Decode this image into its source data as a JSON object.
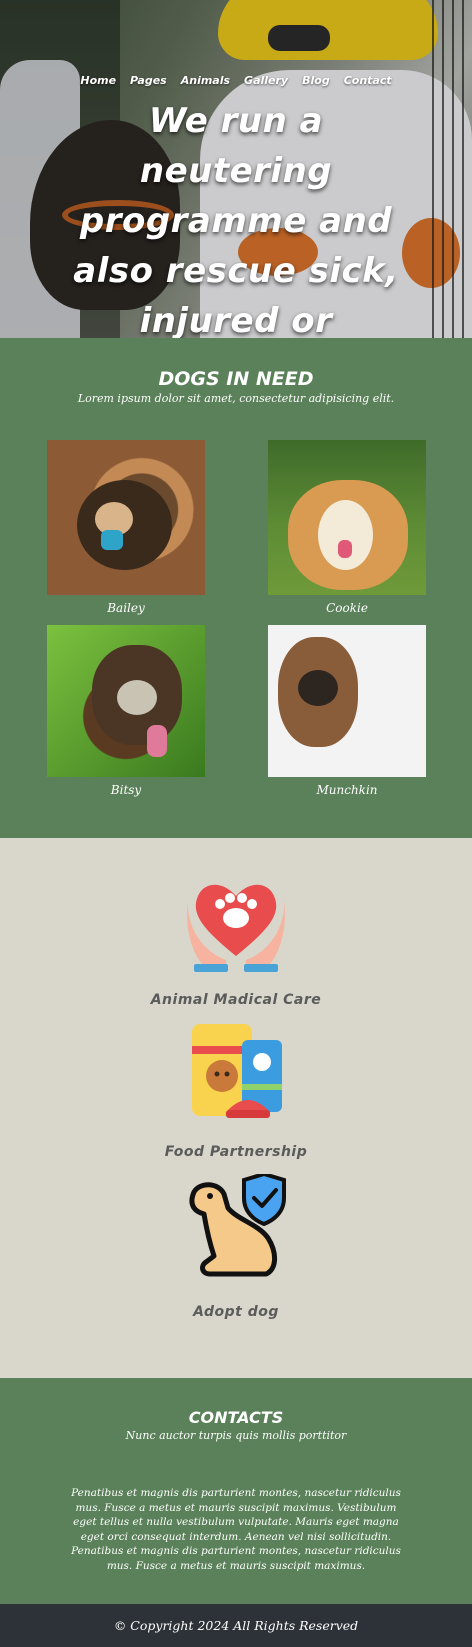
{
  "nav": {
    "items": [
      "Home",
      "Pages",
      "Animals",
      "Gallery",
      "Blog",
      "Contact"
    ]
  },
  "hero": {
    "title": "We run a neutering programme and also rescue sick, injured or neglected dogs."
  },
  "dogs": {
    "title": "DOGS IN NEED",
    "subtitle": "Lorem ipsum dolor sit amet, consectetur adipisicing elit.",
    "items": [
      {
        "name": "Bailey"
      },
      {
        "name": "Cookie"
      },
      {
        "name": "Bitsy"
      },
      {
        "name": "Munchkin"
      }
    ]
  },
  "services": {
    "items": [
      {
        "label": "Animal Madical Care",
        "icon": "heart-paw-hands-icon"
      },
      {
        "label": "Food Partnership",
        "icon": "pet-food-icon"
      },
      {
        "label": "Adopt dog",
        "icon": "dog-shield-icon"
      }
    ]
  },
  "contacts": {
    "title": "CONTACTS",
    "subtitle": "Nunc auctor turpis quis mollis porttitor",
    "body": "Penatibus et magnis dis parturient montes, nascetur ridiculus mus. Fusce a metus et mauris suscipit maximus. Vestibulum eget tellus et nulla vestibulum vulputate. Mauris eget magna eget orci consequat interdum. Aenean vel nisi sollicitudin. Penatibus et magnis dis parturient montes, nascetur ridiculus mus. Fusce a metus et mauris suscipit maximus."
  },
  "footer": {
    "copyright": "© Copyright 2024 All Rights Reserved"
  },
  "colors": {
    "green": "#5a8159",
    "beige": "#d9d6cc",
    "footer": "#2d3238"
  }
}
